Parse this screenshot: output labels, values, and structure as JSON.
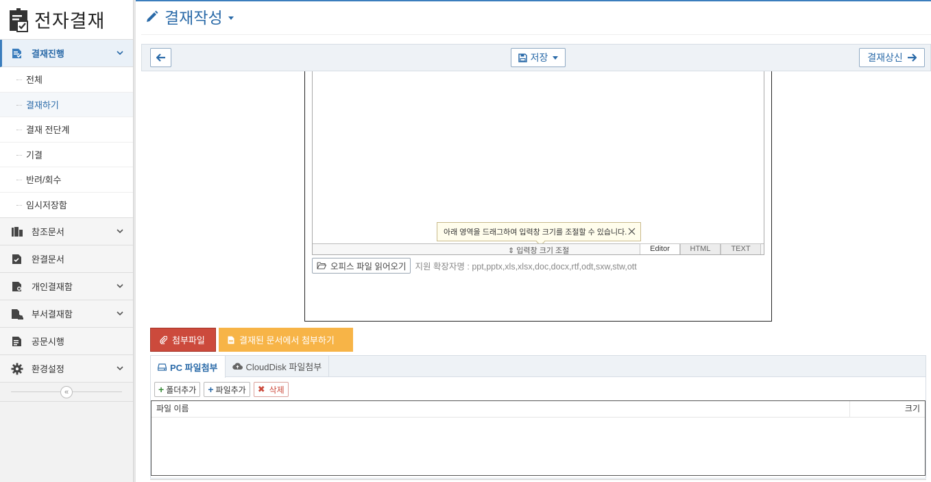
{
  "app": {
    "title": "전자결재"
  },
  "sidebar": {
    "menus": [
      {
        "label": "결재진행",
        "icon": "approval-progress-icon",
        "active": true,
        "expanded": true
      },
      {
        "label": "참조문서",
        "icon": "reference-docs-icon",
        "chevron": true
      },
      {
        "label": "완결문서",
        "icon": "completed-docs-icon",
        "chevron": false
      },
      {
        "label": "개인결재함",
        "icon": "personal-box-icon",
        "chevron": true
      },
      {
        "label": "부서결재함",
        "icon": "department-box-icon",
        "chevron": true
      },
      {
        "label": "공문시행",
        "icon": "official-docs-icon",
        "chevron": false
      },
      {
        "label": "환경설정",
        "icon": "gear-icon",
        "chevron": true
      }
    ],
    "submenu": [
      {
        "label": "전체"
      },
      {
        "label": "결재하기",
        "active": true
      },
      {
        "label": "결재 전단계"
      },
      {
        "label": "기결"
      },
      {
        "label": "반려/회수"
      },
      {
        "label": "임시저장함"
      }
    ],
    "collapse_symbol": "«"
  },
  "header": {
    "title": "결재작성"
  },
  "toolbar": {
    "save_label": "저장",
    "submit_label": "결재상신"
  },
  "editor": {
    "tooltip": "아래 영역을 드래그하여 입력창 크기를 조절할 수 있습니다.",
    "resize_label": "입력창 크기 조절",
    "modes": [
      "Editor",
      "HTML",
      "TEXT"
    ],
    "active_mode": "Editor"
  },
  "office": {
    "button_label": "오피스 파일 읽어오기",
    "extensions": "지원 확장자명 : ppt,pptx,xls,xlsx,doc,docx,rtf,odt,sxw,stw,ott"
  },
  "attachments": {
    "tab_attach": "첨부파일",
    "tab_from_docs": "결재된 문서에서 첨부하기",
    "sub_tabs": [
      "PC 파일첨부",
      "CloudDisk 파일첨부"
    ],
    "buttons": {
      "add_folder": "폴더추가",
      "add_file": "파일추가",
      "delete": "삭제"
    },
    "columns": {
      "name": "파일 이름",
      "size": "크기"
    },
    "rows": []
  },
  "colors": {
    "accent": "#2a6aa8",
    "danger": "#cc4a3c",
    "warning": "#f7b447"
  }
}
